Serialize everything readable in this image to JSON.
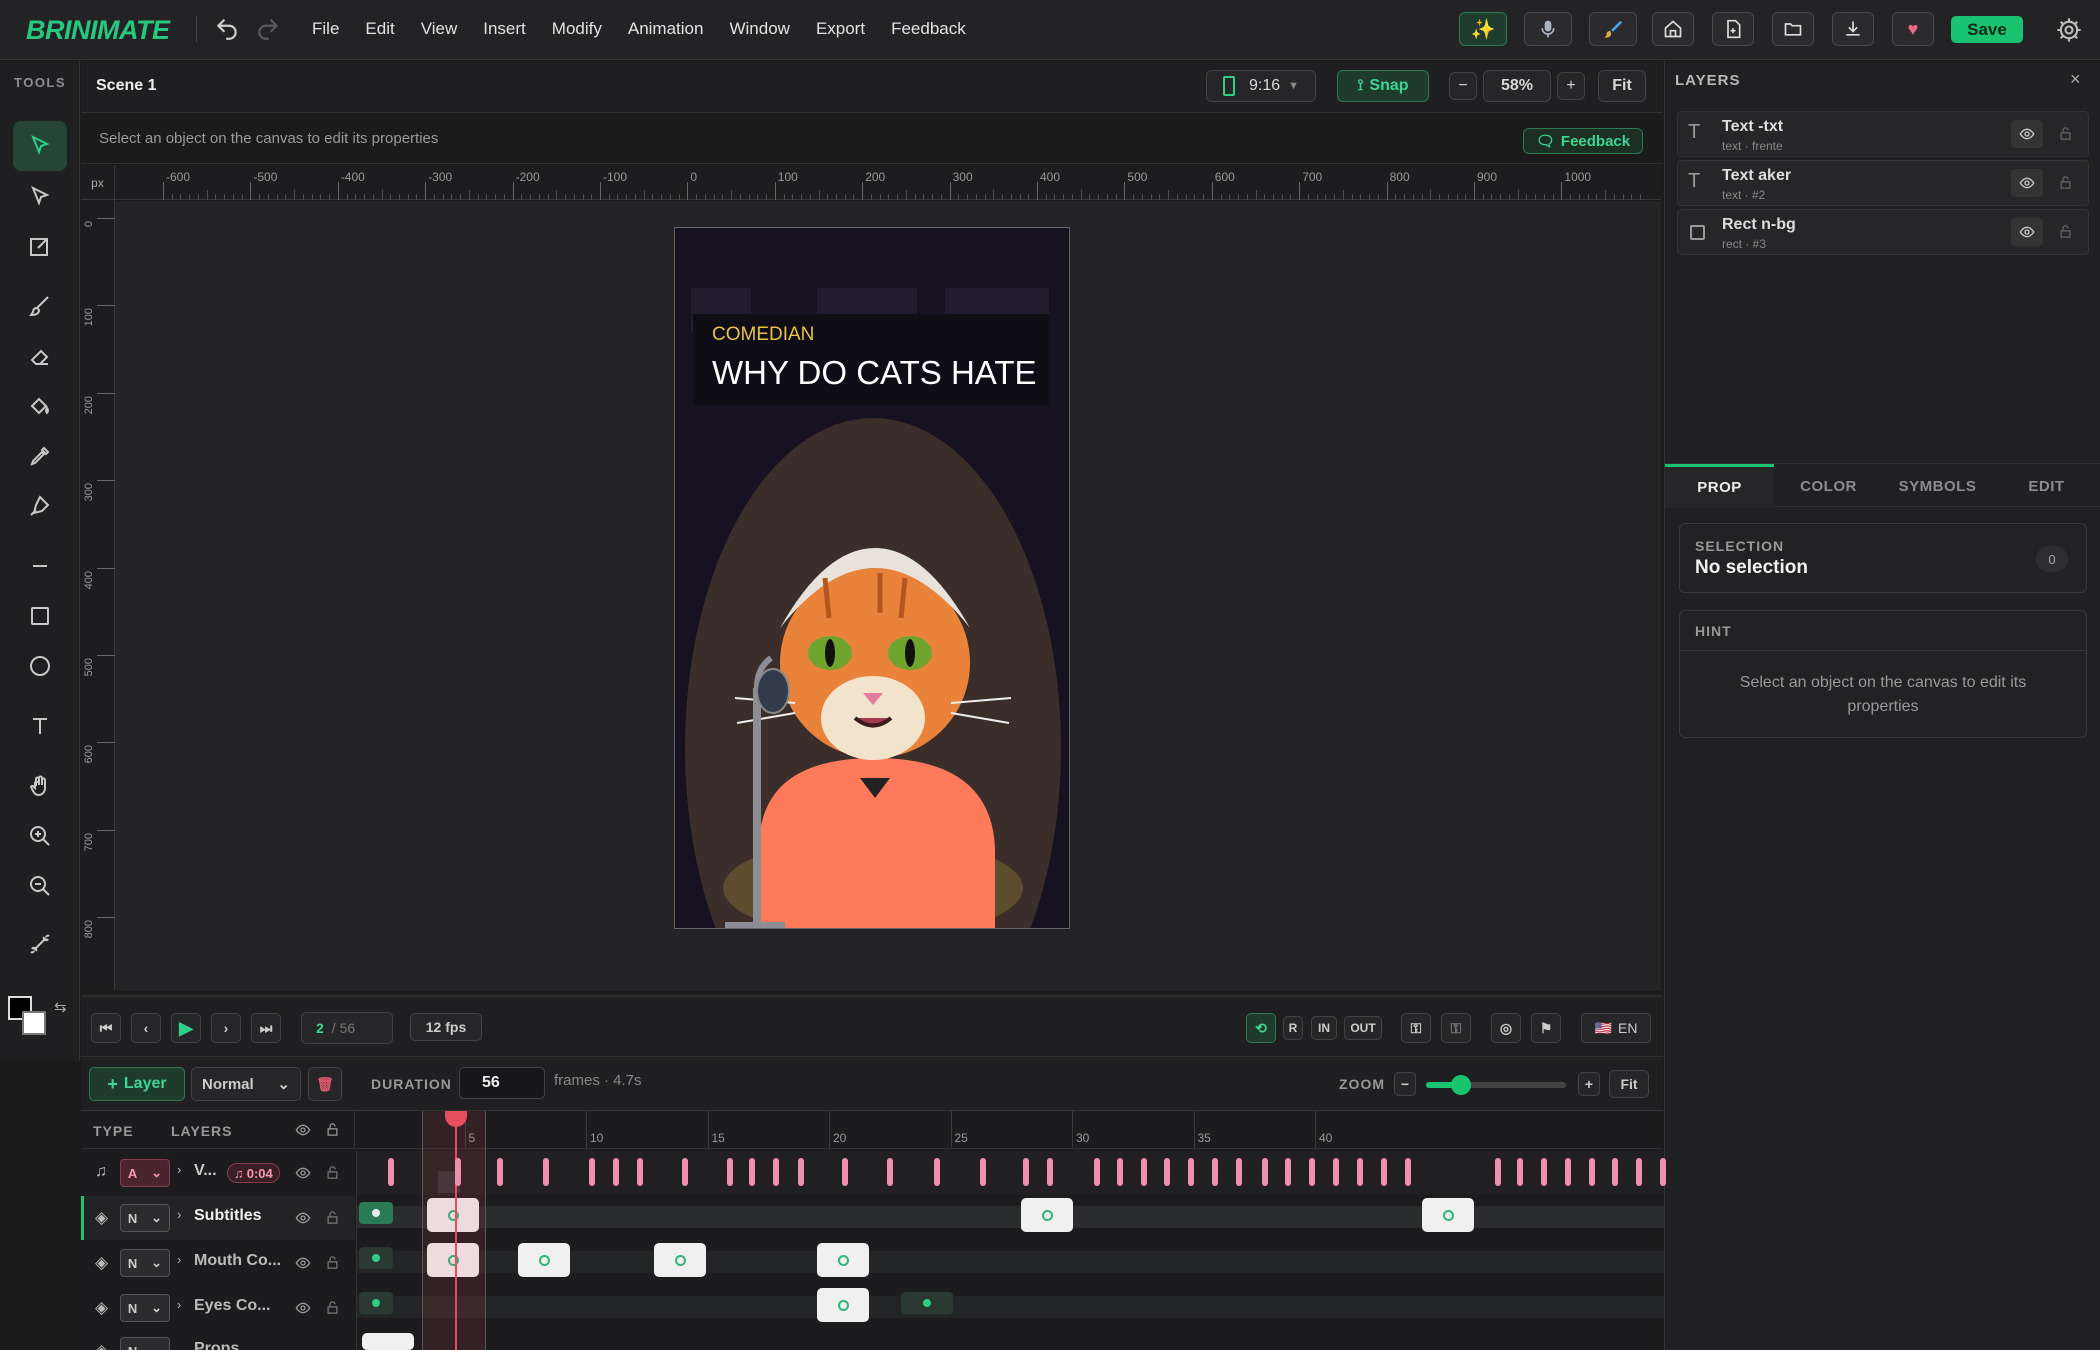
{
  "app": {
    "brand": "BRINIMATE"
  },
  "menu": [
    "File",
    "Edit",
    "View",
    "Insert",
    "Modify",
    "Animation",
    "Window",
    "Export",
    "Feedback"
  ],
  "toolbar": {
    "save_label": "Save"
  },
  "tools": {
    "label": "TOOLS"
  },
  "scene": {
    "name": "Scene 1",
    "aspect": "9:16",
    "snap_label": "Snap",
    "zoom": "58%",
    "fit_label": "Fit",
    "hint": "Select an object on the canvas to edit its properties",
    "feedback_label": "Feedback"
  },
  "ruler": {
    "unit": "px",
    "h_ticks": [
      "-600",
      "-500",
      "-400",
      "-300",
      "-200",
      "-100",
      "0",
      "100",
      "200",
      "300",
      "400",
      "500",
      "600",
      "700",
      "800",
      "900",
      "1000"
    ],
    "v_ticks": [
      "0",
      "100",
      "200",
      "300",
      "400",
      "500",
      "600",
      "700",
      "800"
    ]
  },
  "stage": {
    "subtitle": "COMEDIAN",
    "title": "WHY DO CATS HATE"
  },
  "layers_panel": {
    "title": "LAYERS",
    "items": [
      {
        "name": "Text -txt",
        "meta": "text · frente",
        "icon": "text"
      },
      {
        "name": "Text aker",
        "meta": "text · #2",
        "icon": "text"
      },
      {
        "name": "Rect n-bg",
        "meta": "rect · #3",
        "icon": "rect"
      }
    ]
  },
  "prop_tabs": [
    "PROP",
    "COLOR",
    "SYMBOLS",
    "EDIT"
  ],
  "selection": {
    "label": "SELECTION",
    "value": "No selection",
    "count": "0"
  },
  "hint_card": {
    "title": "HINT",
    "text": "Select an object on the canvas to edit its properties"
  },
  "transport": {
    "frame": "2",
    "total": "/ 56",
    "fps": "12 fps",
    "r_label": "R",
    "in_label": "IN",
    "out_label": "OUT",
    "lang": "EN"
  },
  "layer_bar": {
    "add_label": "Layer",
    "blend": "Normal",
    "duration_label": "DURATION",
    "duration": "56",
    "frames_info": "frames · 4.7s",
    "zoom_label": "ZOOM",
    "zoom_value": 0.25,
    "fit_label": "Fit"
  },
  "timeline": {
    "type_header": "TYPE",
    "layers_header": "LAYERS",
    "frame_ticks": [
      "5",
      "10",
      "15",
      "20",
      "25",
      "30",
      "35",
      "40"
    ],
    "rows": [
      {
        "mode": "A",
        "name": "V...",
        "badge": "0:04"
      },
      {
        "mode": "N",
        "name": "Subtitles"
      },
      {
        "mode": "N",
        "name": "Mouth Co..."
      },
      {
        "mode": "N",
        "name": "Eyes Co..."
      },
      {
        "mode": "N",
        "name": "Props"
      }
    ]
  },
  "colors": {
    "accent": "#19c36f",
    "playhead": "#e84d5b",
    "audio_kf": "#ee8fae"
  }
}
